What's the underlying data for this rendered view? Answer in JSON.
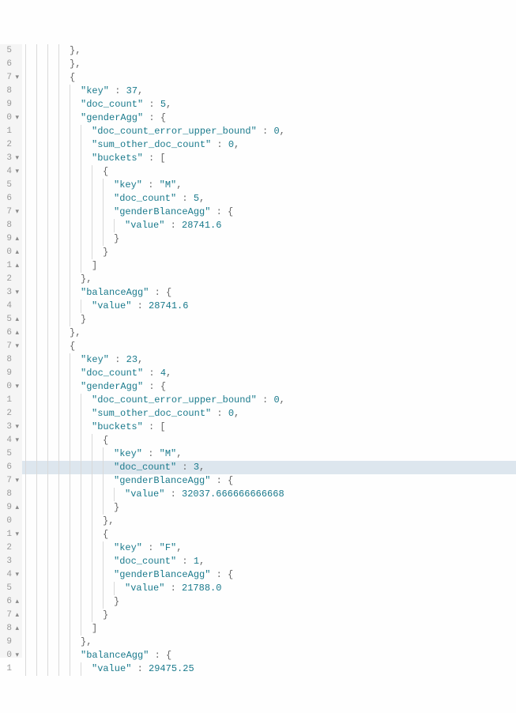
{
  "gutter": [
    {
      "n": "5",
      "f": ""
    },
    {
      "n": "6",
      "f": ""
    },
    {
      "n": "7",
      "f": "▾"
    },
    {
      "n": "8",
      "f": ""
    },
    {
      "n": "9",
      "f": ""
    },
    {
      "n": "0",
      "f": "▾"
    },
    {
      "n": "1",
      "f": ""
    },
    {
      "n": "2",
      "f": ""
    },
    {
      "n": "3",
      "f": "▾"
    },
    {
      "n": "4",
      "f": "▾"
    },
    {
      "n": "5",
      "f": ""
    },
    {
      "n": "6",
      "f": ""
    },
    {
      "n": "7",
      "f": "▾"
    },
    {
      "n": "8",
      "f": ""
    },
    {
      "n": "9",
      "f": "▴"
    },
    {
      "n": "0",
      "f": "▴"
    },
    {
      "n": "1",
      "f": "▴"
    },
    {
      "n": "2",
      "f": ""
    },
    {
      "n": "3",
      "f": "▾"
    },
    {
      "n": "4",
      "f": ""
    },
    {
      "n": "5",
      "f": "▴"
    },
    {
      "n": "6",
      "f": "▴"
    },
    {
      "n": "7",
      "f": "▾"
    },
    {
      "n": "8",
      "f": ""
    },
    {
      "n": "9",
      "f": ""
    },
    {
      "n": "0",
      "f": "▾"
    },
    {
      "n": "1",
      "f": ""
    },
    {
      "n": "2",
      "f": ""
    },
    {
      "n": "3",
      "f": "▾"
    },
    {
      "n": "4",
      "f": "▾"
    },
    {
      "n": "5",
      "f": ""
    },
    {
      "n": "6",
      "f": ""
    },
    {
      "n": "7",
      "f": "▾"
    },
    {
      "n": "8",
      "f": ""
    },
    {
      "n": "9",
      "f": "▴"
    },
    {
      "n": "0",
      "f": ""
    },
    {
      "n": "1",
      "f": "▾"
    },
    {
      "n": "2",
      "f": ""
    },
    {
      "n": "3",
      "f": ""
    },
    {
      "n": "4",
      "f": "▾"
    },
    {
      "n": "5",
      "f": ""
    },
    {
      "n": "6",
      "f": "▴"
    },
    {
      "n": "7",
      "f": "▴"
    },
    {
      "n": "8",
      "f": "▴"
    },
    {
      "n": "9",
      "f": ""
    },
    {
      "n": "0",
      "f": "▾"
    },
    {
      "n": "1",
      "f": ""
    }
  ],
  "lines": [
    {
      "indent": 4,
      "tokens": [
        {
          "t": "},",
          "c": "brace"
        }
      ]
    },
    {
      "indent": 4,
      "tokens": [
        {
          "t": "},",
          "c": "brace"
        }
      ]
    },
    {
      "indent": 4,
      "tokens": [
        {
          "t": "{",
          "c": "brace"
        }
      ]
    },
    {
      "indent": 5,
      "tokens": [
        {
          "t": "\"key\"",
          "c": "key"
        },
        {
          "t": " : ",
          "c": "colon"
        },
        {
          "t": "37",
          "c": "num"
        },
        {
          "t": ",",
          "c": "punc"
        }
      ]
    },
    {
      "indent": 5,
      "tokens": [
        {
          "t": "\"doc_count\"",
          "c": "key"
        },
        {
          "t": " : ",
          "c": "colon"
        },
        {
          "t": "5",
          "c": "num"
        },
        {
          "t": ",",
          "c": "punc"
        }
      ]
    },
    {
      "indent": 5,
      "tokens": [
        {
          "t": "\"genderAgg\"",
          "c": "key"
        },
        {
          "t": " : ",
          "c": "colon"
        },
        {
          "t": "{",
          "c": "brace"
        }
      ]
    },
    {
      "indent": 6,
      "tokens": [
        {
          "t": "\"doc_count_error_upper_bound\"",
          "c": "key"
        },
        {
          "t": " : ",
          "c": "colon"
        },
        {
          "t": "0",
          "c": "num"
        },
        {
          "t": ",",
          "c": "punc"
        }
      ]
    },
    {
      "indent": 6,
      "tokens": [
        {
          "t": "\"sum_other_doc_count\"",
          "c": "key"
        },
        {
          "t": " : ",
          "c": "colon"
        },
        {
          "t": "0",
          "c": "num"
        },
        {
          "t": ",",
          "c": "punc"
        }
      ]
    },
    {
      "indent": 6,
      "tokens": [
        {
          "t": "\"buckets\"",
          "c": "key"
        },
        {
          "t": " : ",
          "c": "colon"
        },
        {
          "t": "[",
          "c": "brace"
        }
      ]
    },
    {
      "indent": 7,
      "tokens": [
        {
          "t": "{",
          "c": "brace"
        }
      ]
    },
    {
      "indent": 8,
      "tokens": [
        {
          "t": "\"key\"",
          "c": "key"
        },
        {
          "t": " : ",
          "c": "colon"
        },
        {
          "t": "\"M\"",
          "c": "str"
        },
        {
          "t": ",",
          "c": "punc"
        }
      ]
    },
    {
      "indent": 8,
      "tokens": [
        {
          "t": "\"doc_count\"",
          "c": "key"
        },
        {
          "t": " : ",
          "c": "colon"
        },
        {
          "t": "5",
          "c": "num"
        },
        {
          "t": ",",
          "c": "punc"
        }
      ]
    },
    {
      "indent": 8,
      "tokens": [
        {
          "t": "\"genderBlanceAgg\"",
          "c": "key"
        },
        {
          "t": " : ",
          "c": "colon"
        },
        {
          "t": "{",
          "c": "brace"
        }
      ]
    },
    {
      "indent": 9,
      "tokens": [
        {
          "t": "\"value\"",
          "c": "key"
        },
        {
          "t": " : ",
          "c": "colon"
        },
        {
          "t": "28741.6",
          "c": "num"
        }
      ]
    },
    {
      "indent": 8,
      "tokens": [
        {
          "t": "}",
          "c": "brace"
        }
      ]
    },
    {
      "indent": 7,
      "tokens": [
        {
          "t": "}",
          "c": "brace"
        }
      ]
    },
    {
      "indent": 6,
      "tokens": [
        {
          "t": "]",
          "c": "brace"
        }
      ]
    },
    {
      "indent": 5,
      "tokens": [
        {
          "t": "},",
          "c": "brace"
        }
      ]
    },
    {
      "indent": 5,
      "tokens": [
        {
          "t": "\"balanceAgg\"",
          "c": "key"
        },
        {
          "t": " : ",
          "c": "colon"
        },
        {
          "t": "{",
          "c": "brace"
        }
      ]
    },
    {
      "indent": 6,
      "tokens": [
        {
          "t": "\"value\"",
          "c": "key"
        },
        {
          "t": " : ",
          "c": "colon"
        },
        {
          "t": "28741.6",
          "c": "num"
        }
      ]
    },
    {
      "indent": 5,
      "tokens": [
        {
          "t": "}",
          "c": "brace"
        }
      ]
    },
    {
      "indent": 4,
      "tokens": [
        {
          "t": "},",
          "c": "brace"
        }
      ]
    },
    {
      "indent": 4,
      "tokens": [
        {
          "t": "{",
          "c": "brace"
        }
      ]
    },
    {
      "indent": 5,
      "tokens": [
        {
          "t": "\"key\"",
          "c": "key"
        },
        {
          "t": " : ",
          "c": "colon"
        },
        {
          "t": "23",
          "c": "num"
        },
        {
          "t": ",",
          "c": "punc"
        }
      ]
    },
    {
      "indent": 5,
      "tokens": [
        {
          "t": "\"doc_count\"",
          "c": "key"
        },
        {
          "t": " : ",
          "c": "colon"
        },
        {
          "t": "4",
          "c": "num"
        },
        {
          "t": ",",
          "c": "punc"
        }
      ]
    },
    {
      "indent": 5,
      "tokens": [
        {
          "t": "\"genderAgg\"",
          "c": "key"
        },
        {
          "t": " : ",
          "c": "colon"
        },
        {
          "t": "{",
          "c": "brace"
        }
      ]
    },
    {
      "indent": 6,
      "tokens": [
        {
          "t": "\"doc_count_error_upper_bound\"",
          "c": "key"
        },
        {
          "t": " : ",
          "c": "colon"
        },
        {
          "t": "0",
          "c": "num"
        },
        {
          "t": ",",
          "c": "punc"
        }
      ]
    },
    {
      "indent": 6,
      "tokens": [
        {
          "t": "\"sum_other_doc_count\"",
          "c": "key"
        },
        {
          "t": " : ",
          "c": "colon"
        },
        {
          "t": "0",
          "c": "num"
        },
        {
          "t": ",",
          "c": "punc"
        }
      ]
    },
    {
      "indent": 6,
      "tokens": [
        {
          "t": "\"buckets\"",
          "c": "key"
        },
        {
          "t": " : ",
          "c": "colon"
        },
        {
          "t": "[",
          "c": "brace"
        }
      ]
    },
    {
      "indent": 7,
      "tokens": [
        {
          "t": "{",
          "c": "brace"
        }
      ]
    },
    {
      "indent": 8,
      "tokens": [
        {
          "t": "\"key\"",
          "c": "key"
        },
        {
          "t": " : ",
          "c": "colon"
        },
        {
          "t": "\"M\"",
          "c": "str"
        },
        {
          "t": ",",
          "c": "punc"
        }
      ]
    },
    {
      "indent": 8,
      "hl": true,
      "tokens": [
        {
          "t": "\"doc_count\"",
          "c": "key"
        },
        {
          "t": " : ",
          "c": "colon"
        },
        {
          "t": "3",
          "c": "num"
        },
        {
          "t": ",",
          "c": "punc"
        }
      ]
    },
    {
      "indent": 8,
      "tokens": [
        {
          "t": "\"genderBlanceAgg\"",
          "c": "key"
        },
        {
          "t": " : ",
          "c": "colon"
        },
        {
          "t": "{",
          "c": "brace"
        }
      ]
    },
    {
      "indent": 9,
      "tokens": [
        {
          "t": "\"value\"",
          "c": "key"
        },
        {
          "t": " : ",
          "c": "colon"
        },
        {
          "t": "32037.666666666668",
          "c": "num"
        }
      ]
    },
    {
      "indent": 8,
      "tokens": [
        {
          "t": "}",
          "c": "brace"
        }
      ]
    },
    {
      "indent": 7,
      "tokens": [
        {
          "t": "},",
          "c": "brace"
        }
      ]
    },
    {
      "indent": 7,
      "tokens": [
        {
          "t": "{",
          "c": "brace"
        }
      ]
    },
    {
      "indent": 8,
      "tokens": [
        {
          "t": "\"key\"",
          "c": "key"
        },
        {
          "t": " : ",
          "c": "colon"
        },
        {
          "t": "\"F\"",
          "c": "str"
        },
        {
          "t": ",",
          "c": "punc"
        }
      ]
    },
    {
      "indent": 8,
      "tokens": [
        {
          "t": "\"doc_count\"",
          "c": "key"
        },
        {
          "t": " : ",
          "c": "colon"
        },
        {
          "t": "1",
          "c": "num"
        },
        {
          "t": ",",
          "c": "punc"
        }
      ]
    },
    {
      "indent": 8,
      "tokens": [
        {
          "t": "\"genderBlanceAgg\"",
          "c": "key"
        },
        {
          "t": " : ",
          "c": "colon"
        },
        {
          "t": "{",
          "c": "brace"
        }
      ]
    },
    {
      "indent": 9,
      "tokens": [
        {
          "t": "\"value\"",
          "c": "key"
        },
        {
          "t": " : ",
          "c": "colon"
        },
        {
          "t": "21788.0",
          "c": "num"
        }
      ]
    },
    {
      "indent": 8,
      "tokens": [
        {
          "t": "}",
          "c": "brace"
        }
      ]
    },
    {
      "indent": 7,
      "tokens": [
        {
          "t": "}",
          "c": "brace"
        }
      ]
    },
    {
      "indent": 6,
      "tokens": [
        {
          "t": "]",
          "c": "brace"
        }
      ]
    },
    {
      "indent": 5,
      "tokens": [
        {
          "t": "},",
          "c": "brace"
        }
      ]
    },
    {
      "indent": 5,
      "tokens": [
        {
          "t": "\"balanceAgg\"",
          "c": "key"
        },
        {
          "t": " : ",
          "c": "colon"
        },
        {
          "t": "{",
          "c": "brace"
        }
      ]
    },
    {
      "indent": 6,
      "tokens": [
        {
          "t": "\"value\"",
          "c": "key"
        },
        {
          "t": " : ",
          "c": "colon"
        },
        {
          "t": "29475.25",
          "c": "num"
        }
      ]
    }
  ]
}
